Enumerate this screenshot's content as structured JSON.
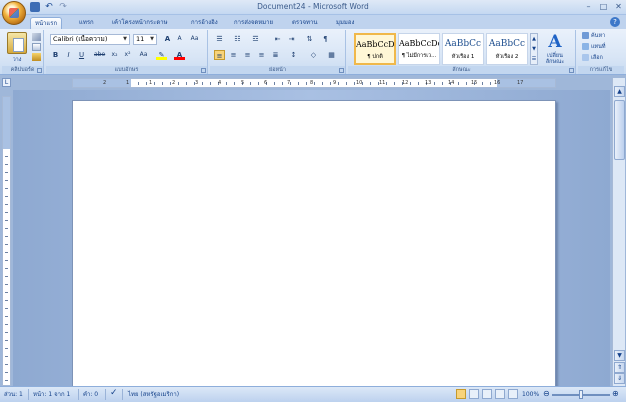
{
  "title_bar": {
    "title": "Document24 - Microsoft Word"
  },
  "tabs": [
    {
      "label": "หน้าแรก"
    },
    {
      "label": "แทรก"
    },
    {
      "label": "เค้าโครงหน้ากระดาษ"
    },
    {
      "label": "การอ้างอิง"
    },
    {
      "label": "การส่งจดหมาย"
    },
    {
      "label": "ตรวจทาน"
    },
    {
      "label": "มุมมอง"
    }
  ],
  "clipboard": {
    "paste_label": "วาง",
    "group_label": "คลิปบอร์ด"
  },
  "font": {
    "name": "Calibri (เนื้อความ)",
    "size": "11",
    "group_label": "แบบอักษร",
    "grow": "A",
    "shrink": "A",
    "clear": "Aa",
    "bold": "B",
    "italic": "I",
    "underline": "U",
    "strike": "abe",
    "subscript": "x₂",
    "superscript": "x²",
    "case": "Aa"
  },
  "paragraph": {
    "group_label": "ย่อหน้า",
    "pilcrow": "¶"
  },
  "styles": {
    "group_label": "ลักษณะ",
    "items": [
      {
        "sample": "AaBbCcDc",
        "name": "¶ ปกติ"
      },
      {
        "sample": "AaBbCcDc",
        "name": "¶ ไม่มีการเว..."
      },
      {
        "sample": "AaBbCc",
        "name": "หัวเรื่อง 1"
      },
      {
        "sample": "AaBbCc",
        "name": "หัวเรื่อง 2"
      }
    ],
    "change_label": "เปลี่ยนลักษณะ"
  },
  "editing": {
    "group_label": "การแก้ไข",
    "find": "ค้นหา",
    "replace": "แทนที่",
    "select": "เลือก"
  },
  "ruler": {
    "numbers": [
      "2",
      "1",
      "1",
      "2",
      "3",
      "4",
      "5",
      "6",
      "7",
      "8",
      "9",
      "10",
      "11",
      "12",
      "13",
      "14",
      "15",
      "16",
      "17"
    ]
  },
  "status": {
    "section": "ส่วน: 1",
    "page": "หน้า: 1 จาก 1",
    "words": "คำ: 0",
    "language": "ไทย (สหรัฐอเมริกา)",
    "zoom": "100%",
    "zoom_level": 0.5
  },
  "colors": {
    "highlight": "#ffff00",
    "font_color": "#ff0000",
    "accent": "#15428b"
  }
}
